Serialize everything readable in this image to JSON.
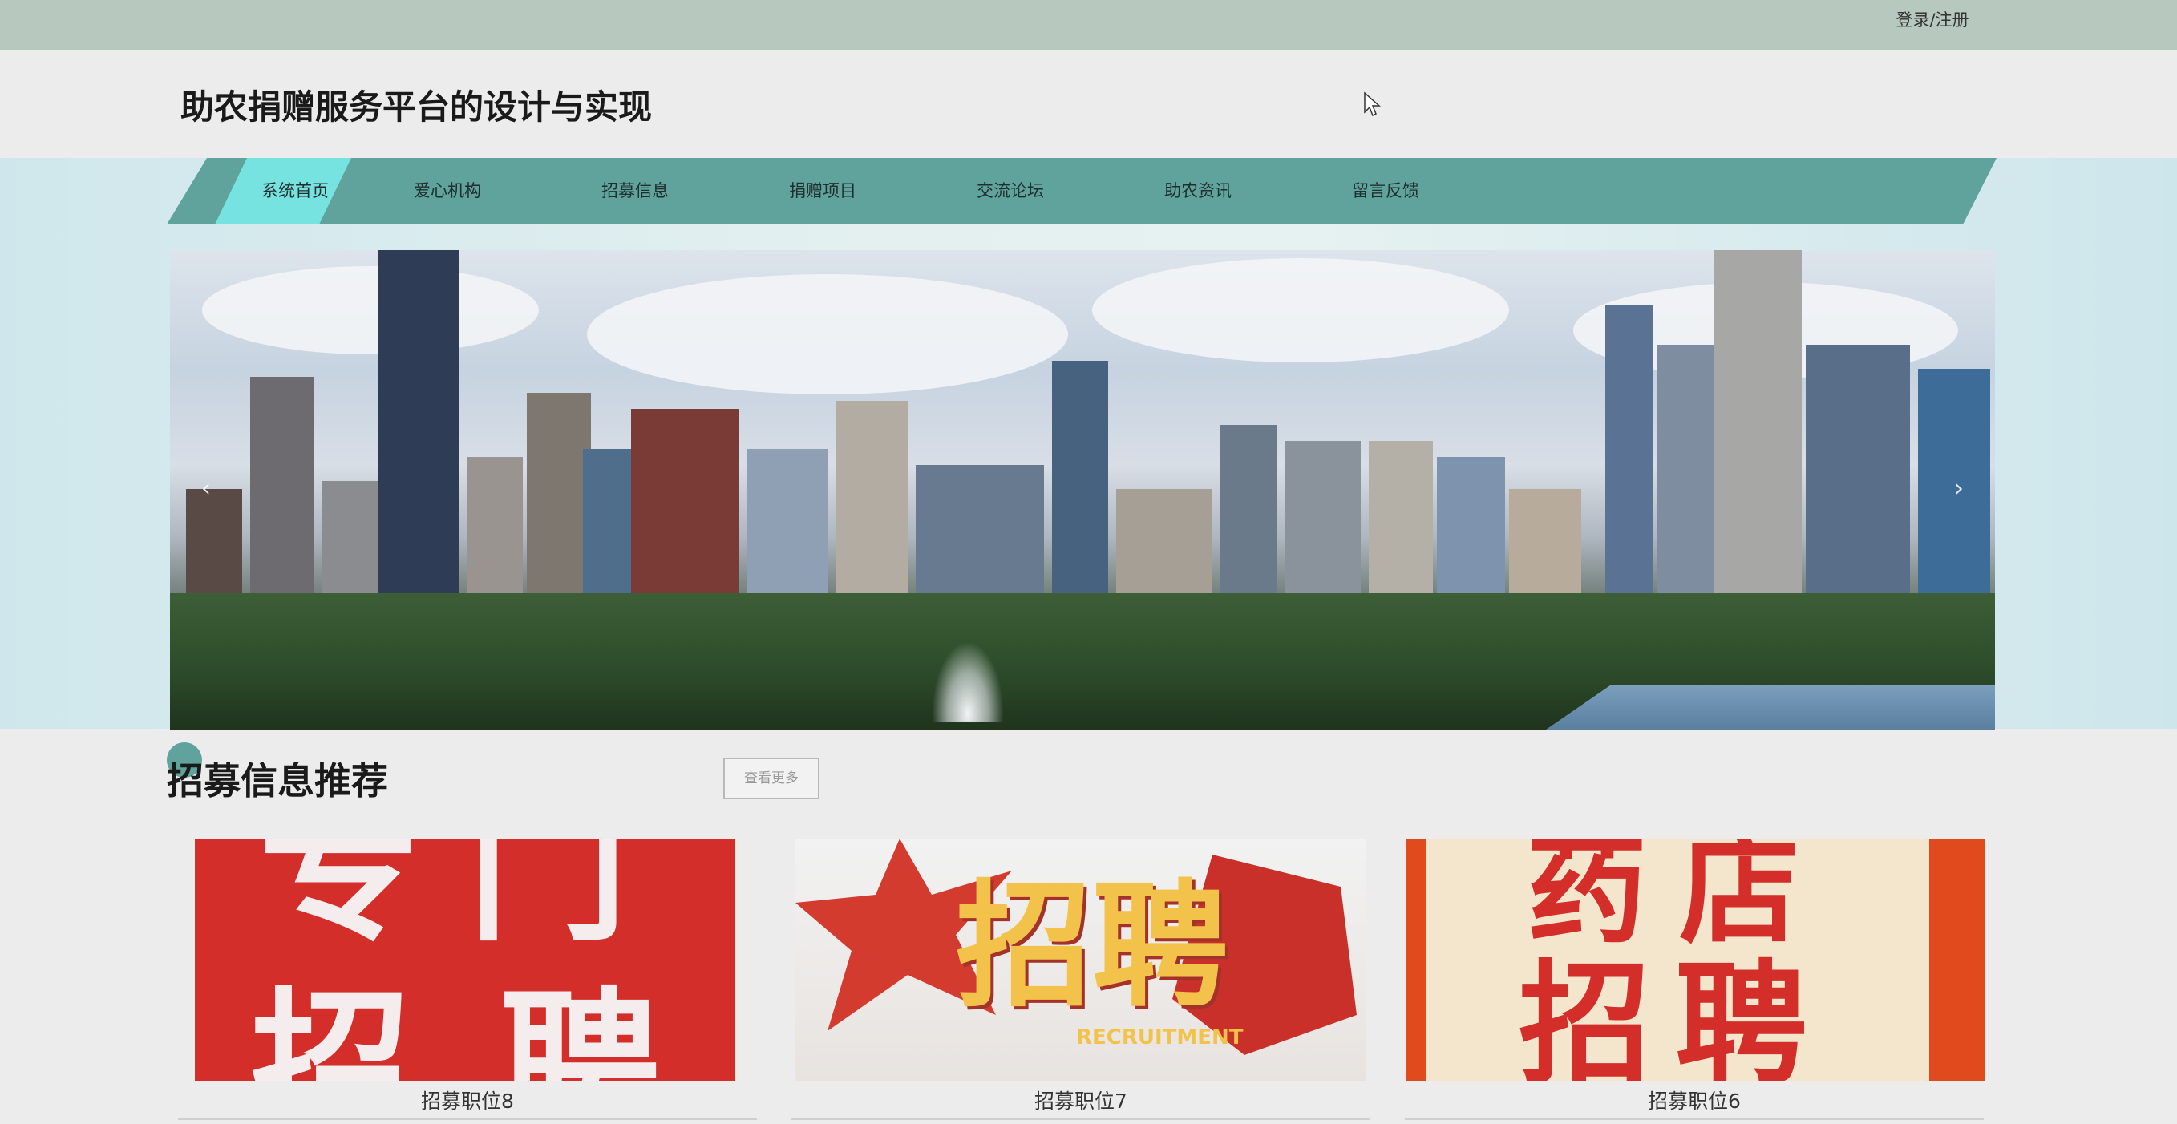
{
  "topbar": {
    "login_label": "登录/注册"
  },
  "header": {
    "site_title": "助农捐赠服务平台的设计与实现"
  },
  "nav": {
    "items": [
      {
        "label": "系统首页",
        "active": true
      },
      {
        "label": "爱心机构",
        "active": false
      },
      {
        "label": "招募信息",
        "active": false
      },
      {
        "label": "捐赠项目",
        "active": false
      },
      {
        "label": "交流论坛",
        "active": false
      },
      {
        "label": "助农资讯",
        "active": false
      },
      {
        "label": "留言反馈",
        "active": false
      }
    ]
  },
  "banner": {
    "prev_icon": "‹",
    "next_icon": "›"
  },
  "section": {
    "title": "招募信息推荐",
    "more_label": "查看更多"
  },
  "cards": [
    {
      "label": "招募职位8",
      "poster_line1": "专门",
      "poster_line2": "招聘"
    },
    {
      "label": "招募职位7",
      "poster_line1": "招聘",
      "poster_line2": "RECRUITMENT"
    },
    {
      "label": "招募职位6",
      "poster_line1": "药店",
      "poster_line2": "招聘"
    }
  ],
  "colors": {
    "topbar": "#b7c8bf",
    "nav": "#5fa39c",
    "nav_active": "#77e3e0",
    "poster_red": "#d42e2a",
    "poster_cream": "#f3e6cc"
  },
  "icons": {
    "cursor": "cursor-icon",
    "prev": "chevron-left-icon",
    "next": "chevron-right-icon"
  }
}
